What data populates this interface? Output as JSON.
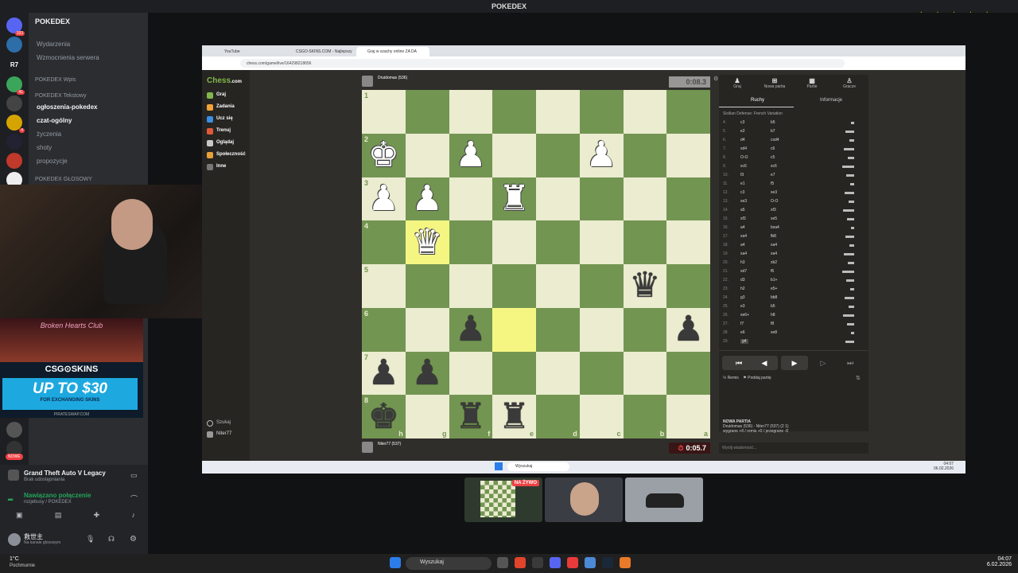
{
  "topbar": {
    "title": "POKEDEX"
  },
  "stars": "★★★★★",
  "servers": [
    {
      "badge": "193"
    },
    {
      "badge": ""
    },
    {
      "label": "R7"
    },
    {
      "badge": "41"
    },
    {
      "badge": ""
    },
    {
      "badge": "4"
    },
    {
      "badge": ""
    },
    {
      "badge": ""
    },
    {
      "badge": ""
    }
  ],
  "sidebar": {
    "server_name": "POKEDEX",
    "events": "Wydarzenia",
    "boosts": "Wzmocnienia serwera",
    "cat_posts": "POKEDEX Wpis",
    "cat_text": "POKEDEX Tekstowy",
    "channels": [
      "ogłoszenia-pokedex",
      "czat-ogólny",
      "życzenia",
      "shoty",
      "propozycje"
    ],
    "cat_voice": "POKEDEX GŁOSOWY"
  },
  "ads": {
    "club": "Broken Hearts Club",
    "logo": "CSG⊙SKINS",
    "headline": "UP TO $30",
    "sub": "FOR EXCHANGING SKINS",
    "foot": "PIRATESWAP.COM",
    "new_badge": "NOWE"
  },
  "voice": {
    "game": "Grand Theft Auto V Legacy",
    "game_sub": "Brak udostępniania",
    "connected": "Nawiązano połączenie",
    "channel": "rozjebusy / POKEDEX",
    "user": "救世主",
    "user_status": "Na kanale głosowym"
  },
  "browser": {
    "tabs": [
      "YouTube",
      "CSGO-SKINS.COM - Najlepszy",
      "Graj w szachy online ZA DA"
    ],
    "url": "chess.com/game/live/164298218656"
  },
  "chess": {
    "logo_a": "Chess",
    "logo_b": ".com",
    "nav": [
      "Graj",
      "Zadania",
      "Ucz się",
      "Trenuj",
      "Oglądaj",
      "Społeczność",
      "Inne"
    ],
    "nav_bottom": [
      "Szukaj",
      "Niter77"
    ],
    "top_player": "Druidomas (536)",
    "top_clock": "0:08.3",
    "bottom_player": "Niter77 (537)",
    "bottom_clock": "0:05.7",
    "ranks": [
      "1",
      "2",
      "3",
      "4",
      "5",
      "6",
      "7",
      "8"
    ],
    "files": [
      "h",
      "g",
      "f",
      "e",
      "d",
      "c",
      "b",
      "a"
    ],
    "board": [
      [
        "",
        "",
        "",
        "",
        "",
        "",
        "",
        ""
      ],
      [
        "wK",
        "",
        "wP",
        "",
        "",
        "wP",
        "",
        ""
      ],
      [
        "wP",
        "wP",
        "",
        "wR",
        "",
        "",
        "",
        ""
      ],
      [
        "",
        "wQ",
        "",
        "",
        "",
        "",
        "",
        ""
      ],
      [
        "",
        "",
        "",
        "",
        "",
        "",
        "bQ",
        ""
      ],
      [
        "",
        "",
        "bP",
        "",
        "",
        "",
        "",
        "bP"
      ],
      [
        "bP",
        "bP",
        "",
        "",
        "",
        "",
        "",
        ""
      ],
      [
        "bK",
        "",
        "bR",
        "bR",
        "",
        "",
        "",
        ""
      ]
    ],
    "highlight": [
      [
        3,
        1
      ],
      [
        5,
        3
      ]
    ],
    "panel": {
      "icons": [
        "Graj",
        "Nowa partia",
        "Partie",
        "Gracze"
      ],
      "tabs": [
        "Ruchy",
        "Informacje"
      ],
      "opening": "Sicilian Defense: French Variation",
      "moves": [
        [
          "4.",
          "c3",
          "b5"
        ],
        [
          "5.",
          "e2",
          "b7"
        ],
        [
          "6.",
          "d4",
          "cxd4"
        ],
        [
          "7.",
          "xd4",
          "c6"
        ],
        [
          "8.",
          "O-O",
          "c5"
        ],
        [
          "9.",
          "xc6",
          "xc6"
        ],
        [
          "10.",
          "f3",
          "e7"
        ],
        [
          "11.",
          "e1",
          "f5"
        ],
        [
          "12.",
          "c3",
          "xe3"
        ],
        [
          "13.",
          "xe3",
          "O-O"
        ],
        [
          "14.",
          "a5",
          "xf3"
        ],
        [
          "15.",
          "xf3",
          "xe5"
        ],
        [
          "16.",
          "a4",
          "bxa4"
        ],
        [
          "17.",
          "xa4",
          "fb8"
        ],
        [
          "18.",
          "a4",
          "xa4"
        ],
        [
          "19.",
          "xa4",
          "xa4"
        ],
        [
          "20.",
          "h3",
          "xb2"
        ],
        [
          "21.",
          "xd7",
          "f6"
        ],
        [
          "22.",
          "d3",
          "b1+"
        ],
        [
          "23.",
          "h2",
          "e5+"
        ],
        [
          "24.",
          "g3",
          "bb8"
        ],
        [
          "25.",
          "e3",
          "b5"
        ],
        [
          "26.",
          "xe6+",
          "h8"
        ],
        [
          "27.",
          "f7",
          "f8"
        ],
        [
          "28.",
          "e6",
          "xe8"
        ],
        [
          "29.",
          "g4",
          ""
        ]
      ],
      "controls": [
        "⏮",
        "◀",
        "▶",
        "▷",
        "⏭"
      ],
      "remis": "Remis",
      "resign": "Poddaj partię",
      "new_game": "NOWA PARTIA",
      "result_line": "Druidomas (536) - Niter77 (537) (2 1)",
      "stats": "wygrane +8 / remis +0 / przegrane -8",
      "message_placeholder": "Wyślij wiadomość..."
    }
  },
  "inner_taskbar": {
    "search": "Wyszukaj",
    "time": "04:07",
    "date": "06.02.2026"
  },
  "thumbs": {
    "live": "NA ŻYWO"
  },
  "taskbar": {
    "weather": "1°C",
    "weather_sub": "Pochmurnie",
    "search": "Wyszukaj",
    "time": "04:07",
    "date": "6.02.2026"
  }
}
